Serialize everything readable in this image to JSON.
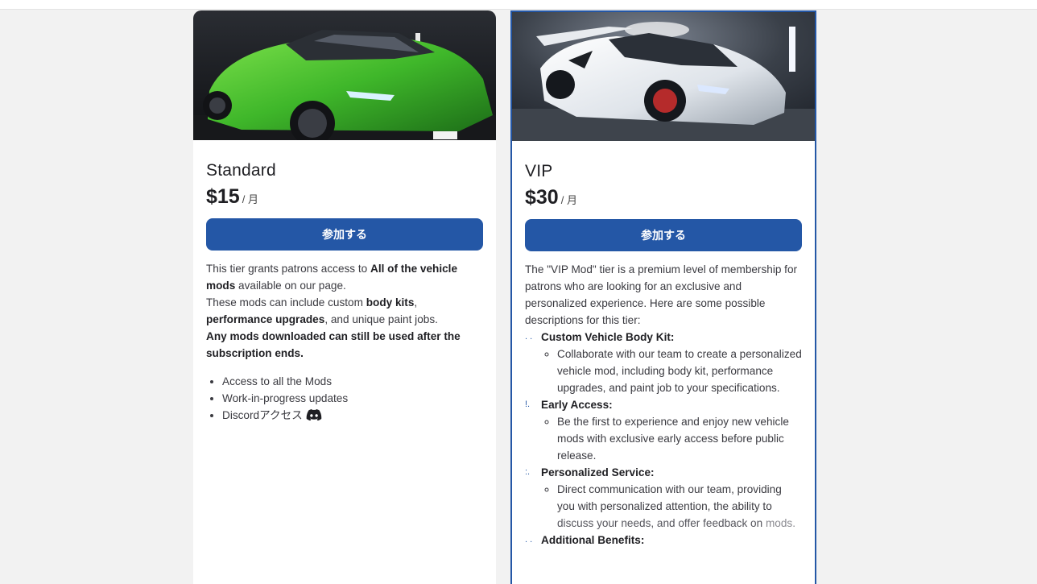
{
  "colors": {
    "accent": "#2457a6",
    "page_bg": "#f2f2f2",
    "card_bg": "#ffffff"
  },
  "tiers": [
    {
      "name": "Standard",
      "price": "$15",
      "period": "/ 月",
      "join_label": "参加する",
      "description": {
        "p1_a": "This tier grants patrons access to ",
        "p1_b": "All of the vehicle mods",
        "p1_c": " available on our page.",
        "p2_a": "These mods can include custom ",
        "p2_b": "body kits",
        "p2_c": ", ",
        "p2_d": "performance upgrades",
        "p2_e": ", and unique paint jobs.",
        "p3": "Any mods downloaded can still be used after the subscription ends."
      },
      "features": [
        "Access to all the Mods",
        "Work-in-progress updates",
        "Discordアクセス"
      ],
      "feature_icon": "discord-icon"
    },
    {
      "name": "VIP",
      "price": "$30",
      "period": "/ 月",
      "join_label": "参加する",
      "intro": "The \"VIP Mod\" tier is a premium level of membership for patrons who are looking for an exclusive and personalized experience. Here are some possible descriptions for this tier:",
      "benefits": [
        {
          "heading": "Custom Vehicle Body Kit:",
          "detail": "Collaborate with our team to create a personalized vehicle mod, including body kit, performance upgrades, and paint job to your specifications."
        },
        {
          "heading": "Early Access:",
          "detail": "Be the first to experience and enjoy new vehicle mods with exclusive early access before public release."
        },
        {
          "heading": "Personalized Service:",
          "detail_a": "Direct communication with our team, providing you with personalized attention, the ability to",
          "detail_b": "discuss your needs, and offer feedback on",
          "detail_c": "mods."
        },
        {
          "heading": "Additional Benefits:"
        }
      ]
    }
  ]
}
